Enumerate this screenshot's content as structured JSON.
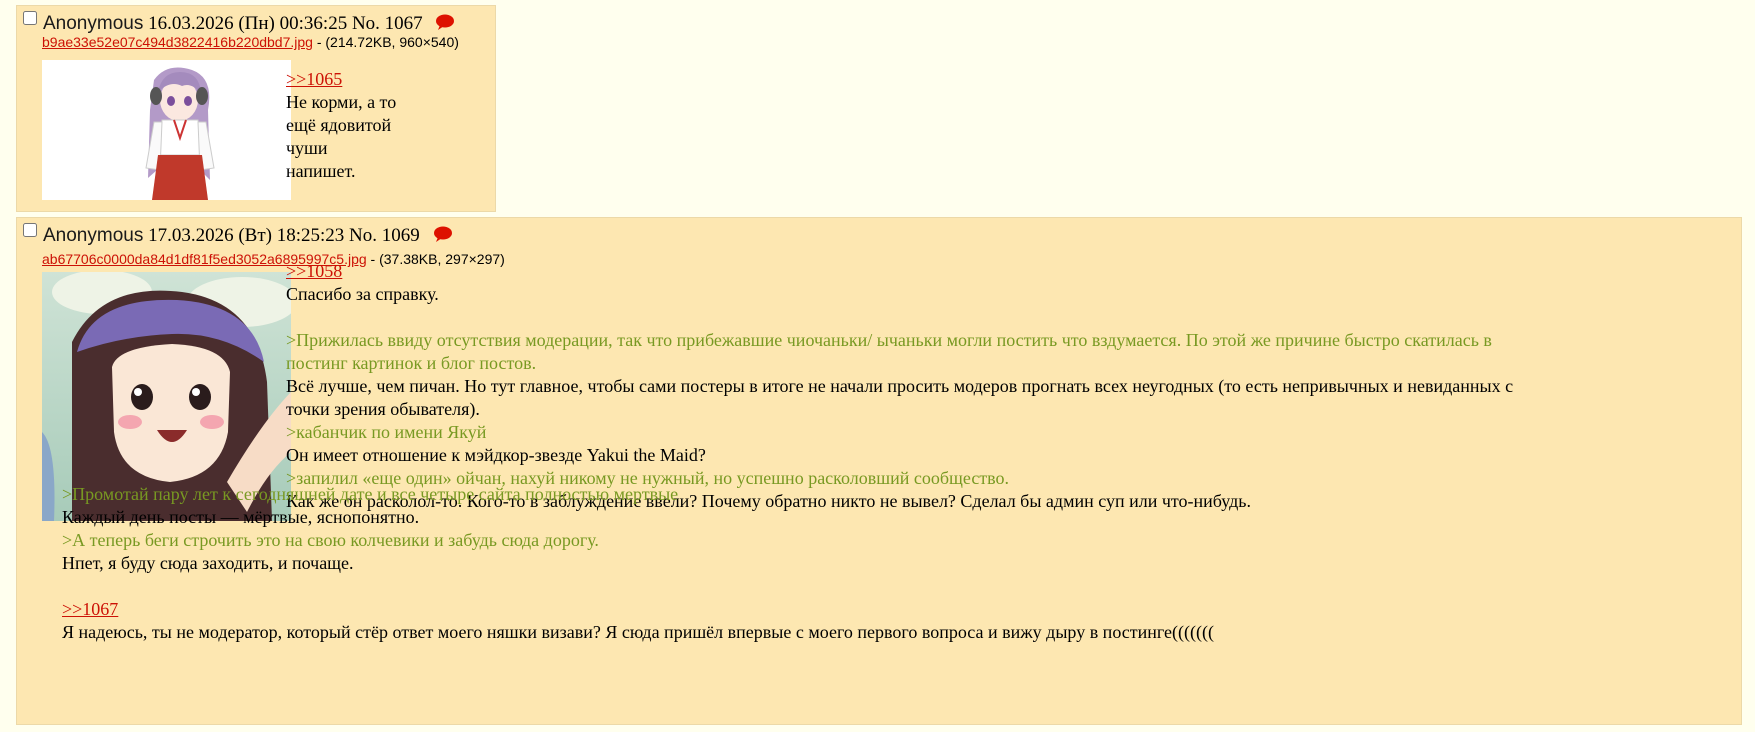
{
  "posts": [
    {
      "name": "Anonymous",
      "date": "16.03.2026 (Пн) 00:36:25",
      "number": "No. 1067",
      "file_name": "b9ae33e52e07c494d3822416b220dbd7.jpg",
      "file_meta": " - (214.72KB, 960×540)",
      "quote_link": ">>1065",
      "lines": [
        "Не корми, а то",
        "ещё ядовитой",
        "чуши",
        "напишет."
      ]
    },
    {
      "name": "Anonymous",
      "date": "17.03.2026 (Вт) 18:25:23",
      "number": "No. 1069",
      "file_name": "ab67706c0000da84d1df81f5ed3052a6895997c5.jpg",
      "file_meta": " - (37.38KB, 297×297)",
      "quote_link_1": ">>1058",
      "line_1": "Спасибо за справку.",
      "greentext_1a": ">Прижилась ввиду отсутствия модерации, так что прибежавшие чиочаньки/ ычаньки могли постить что вздумается. По этой же причине быстро скатилась в",
      "greentext_1b": "постинг картинок и блог постов.",
      "line_2a": "Всё лучше, чем пичан. Но тут главное, чтобы сами постеры в итоге не начали просить модеров прогнать всех неугодных (то есть непривычных и невиданных с",
      "line_2b": "точки зрения обывателя).",
      "greentext_2": ">кабанчик по имени Якуй",
      "line_3": "Он имеет отношение к мэйдкор-звезде Yakui the Maid?",
      "greentext_3": ">запилил «еще один» ойчан, нахуй никому не нужный, но успешно расколовший сообщество.",
      "line_4": "Как же он расколол-то. Кого-то в заблуждение ввели? Почему обратно никто не вывел? Сделал бы админ суп или что-нибудь.",
      "greentext_4": ">Промотай пару лет к сегодняшней дате и все четыре сайта полностью мертвые",
      "line_5": "Каждый день посты — мёртвые, яснопонятно.",
      "greentext_5": ">А теперь беги строчить это на свою колчевики и забудь сюда дорогу.",
      "line_6": "Нпет, я буду сюда заходить, и почаще.",
      "quote_link_2": ">>1067",
      "line_7": "Я надеюсь, ты не модератор, который стёр ответ моего няшки визави? Я сюда пришёл впервые с моего первого вопроса и вижу дыру в постинге((((((("
    }
  ],
  "colors": {
    "post_bg": "#fde7b1",
    "page_bg": "#ffffee",
    "link": "#cc1105",
    "greentext": "#789922",
    "bubble_icon": "#dd1100"
  },
  "icons": [
    "checkbox",
    "reply-bubble-icon",
    "thumbnail-image"
  ]
}
